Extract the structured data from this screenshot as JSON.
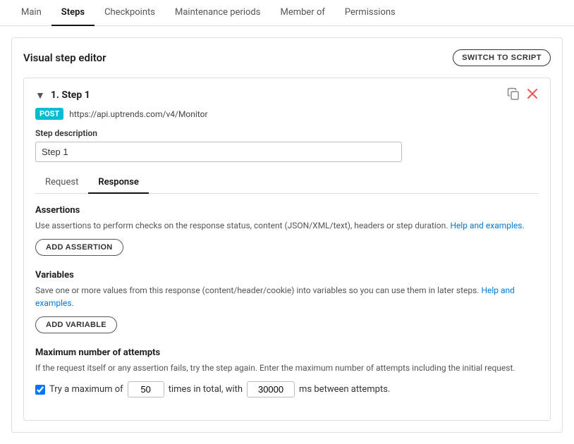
{
  "nav": {
    "tabs": [
      {
        "label": "Main",
        "active": false
      },
      {
        "label": "Steps",
        "active": true
      },
      {
        "label": "Checkpoints",
        "active": false
      },
      {
        "label": "Maintenance periods",
        "active": false
      },
      {
        "label": "Member of",
        "active": false
      },
      {
        "label": "Permissions",
        "active": false
      }
    ]
  },
  "editor": {
    "title": "Visual step editor",
    "switch_btn_label": "SWITCH TO SCRIPT"
  },
  "step": {
    "number": "1",
    "title": "1. Step 1",
    "method": "POST",
    "url": "https://api.uptrends.com/v4/Monitor",
    "description_label": "Step description",
    "description_value": "Step 1"
  },
  "sub_tabs": [
    {
      "label": "Request",
      "active": false
    },
    {
      "label": "Response",
      "active": true
    }
  ],
  "assertions": {
    "title": "Assertions",
    "description": "Use assertions to perform checks on the response status, content (JSON/XML/text), headers or step duration.",
    "link_text": "Help and examples",
    "button_label": "ADD ASSERTION"
  },
  "variables": {
    "title": "Variables",
    "description": "Save one or more values from this response (content/header/cookie) into variables so you can use them in later steps.",
    "link_text": "Help and examples",
    "button_label": "ADD VARIABLE"
  },
  "max_attempts": {
    "title": "Maximum number of attempts",
    "description": "If the request itself or any assertion fails, try the step again. Enter the maximum number of attempts including the initial request.",
    "checkbox_checked": true,
    "prefix_text": "Try a maximum of",
    "attempts_value": "50",
    "middle_text": "times in total, with",
    "ms_value": "30000",
    "suffix_text": "ms between attempts."
  }
}
